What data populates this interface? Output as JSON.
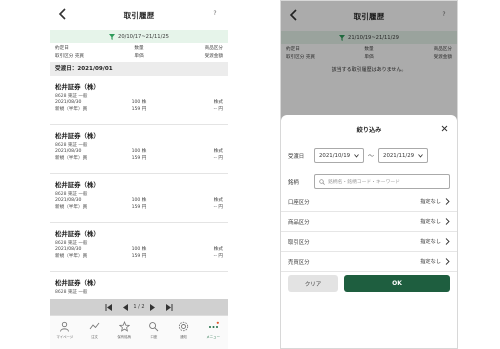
{
  "colors": {
    "accent": "#1e5e3f",
    "daterow_bg": "#e6f4ea",
    "funnel": "#2e9b5a"
  },
  "left": {
    "header": {
      "title": "取引履歴",
      "help": "?"
    },
    "date_range": "20/10/17~21/11/25",
    "columns": {
      "row1": [
        "約定日",
        "数量",
        "商品区分"
      ],
      "row2": [
        "取引区分 売買",
        "単価",
        "受渡金額"
      ]
    },
    "section_label": "受渡日：2021/09/01",
    "entries": [
      {
        "name": "松井証券（株）",
        "sub": "8628 東証 一般",
        "date": "2021/08/30",
        "qty": "100 株",
        "cat": "株式",
        "type": "新規（半年）買",
        "price": "159 円",
        "amount": "-- 円"
      },
      {
        "name": "松井証券（株）",
        "sub": "8628 東証 一般",
        "date": "2021/08/30",
        "qty": "100 株",
        "cat": "株式",
        "type": "新規（半年）買",
        "price": "159 円",
        "amount": "-- 円"
      },
      {
        "name": "松井証券（株）",
        "sub": "8628 東証 一般",
        "date": "2021/08/30",
        "qty": "100 株",
        "cat": "株式",
        "type": "新規（半年）買",
        "price": "159 円",
        "amount": "-- 円"
      },
      {
        "name": "松井証券（株）",
        "sub": "8628 東証 一般",
        "date": "2021/08/30",
        "qty": "100 株",
        "cat": "株式",
        "type": "新規（半年）買",
        "price": "159 円",
        "amount": "-- 円"
      },
      {
        "name": "松井証券（株）",
        "sub": "8628 東証 一般",
        "date": "",
        "qty": "",
        "cat": "",
        "type": "",
        "price": "",
        "amount": ""
      }
    ],
    "pager": "1 / 2",
    "tabs": [
      {
        "label": "マイページ",
        "icon": "person-icon"
      },
      {
        "label": "注文",
        "icon": "chart-icon"
      },
      {
        "label": "保有銘柄",
        "icon": "star-icon"
      },
      {
        "label": "口座",
        "icon": "search-icon"
      },
      {
        "label": "通知",
        "icon": "gear-icon"
      },
      {
        "label": "メニュー",
        "icon": "more-icon"
      }
    ]
  },
  "right": {
    "header": {
      "title": "取引履歴",
      "help": "?"
    },
    "date_range": "21/10/19~21/11/29",
    "columns": {
      "row1": [
        "約定日",
        "数量",
        "商品区分"
      ],
      "row2": [
        "取引区分 売買",
        "単価",
        "受渡金額"
      ]
    },
    "empty_message": "該当する取引履歴はありません。",
    "sheet": {
      "title": "絞り込み",
      "date_label": "受渡日",
      "date_from": "2021/10/19",
      "date_to": "2021/11/29",
      "tilde": "〜",
      "search_label": "銘柄",
      "search_placeholder": "銘柄名・銘柄コード・キーワード",
      "options": [
        {
          "label": "口座区分",
          "value": "指定なし"
        },
        {
          "label": "商品区分",
          "value": "指定なし"
        },
        {
          "label": "取引区分",
          "value": "指定なし"
        },
        {
          "label": "売買区分",
          "value": "指定なし"
        }
      ],
      "clear_label": "クリア",
      "ok_label": "OK"
    }
  }
}
